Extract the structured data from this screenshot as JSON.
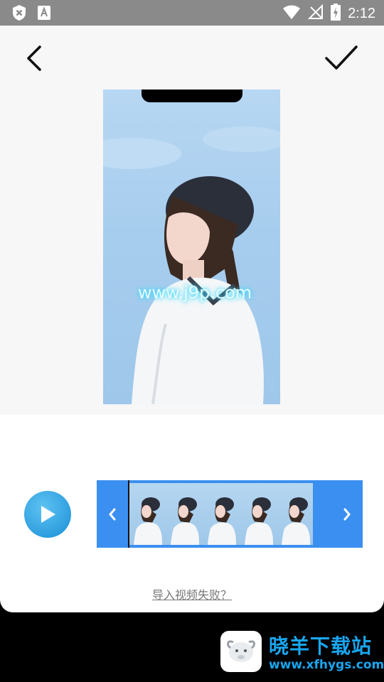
{
  "status_bar": {
    "time": "2:12",
    "left_icons": [
      "shield-x-icon",
      "font-a-icon"
    ],
    "right_icons": [
      "wifi-icon",
      "no-signal-icon",
      "battery-charging-icon"
    ]
  },
  "header": {
    "back_icon": "back-chevron-icon",
    "confirm_icon": "checkmark-icon"
  },
  "preview": {
    "watermark": "www.j9p.com"
  },
  "timeline": {
    "frame_count": 5,
    "left_arrow_icon": "chevron-left-icon",
    "right_arrow_icon": "chevron-right-icon"
  },
  "footer": {
    "import_failed_link": "导入视频失败？"
  },
  "branding": {
    "name": "晓羊下载站",
    "url": "www.xfhygs.com"
  },
  "colors": {
    "accent": "#3b8ff0",
    "play_button": "#1a8fd6",
    "brand": "#19a6f0"
  }
}
